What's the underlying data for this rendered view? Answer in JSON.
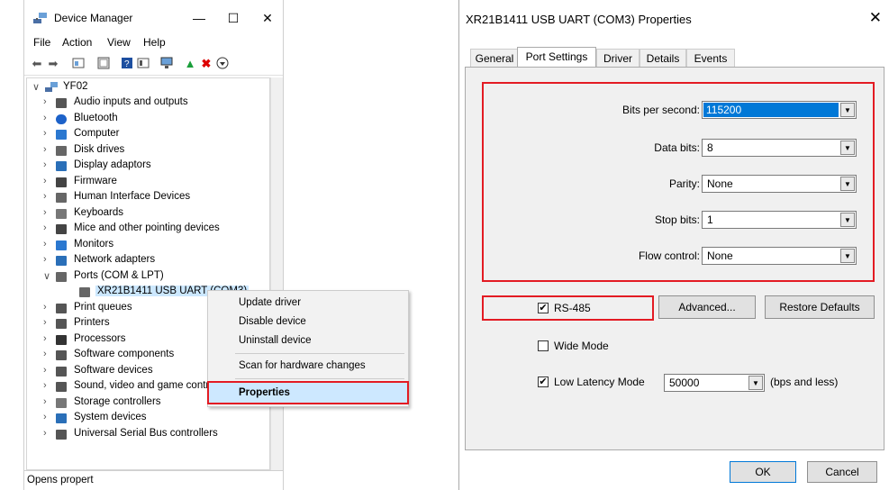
{
  "device_manager": {
    "title": "Device Manager",
    "menu": [
      "File",
      "Action",
      "View",
      "Help"
    ],
    "root": "YF02",
    "tree": [
      {
        "label": "Audio inputs and outputs",
        "icon": "speaker-icon"
      },
      {
        "label": "Bluetooth",
        "icon": "bluetooth-icon"
      },
      {
        "label": "Computer",
        "icon": "computer-icon"
      },
      {
        "label": "Disk drives",
        "icon": "disk-icon"
      },
      {
        "label": "Display adaptors",
        "icon": "display-adapter-icon"
      },
      {
        "label": "Firmware",
        "icon": "firmware-icon"
      },
      {
        "label": "Human Interface Devices",
        "icon": "hid-icon"
      },
      {
        "label": "Keyboards",
        "icon": "keyboard-icon"
      },
      {
        "label": "Mice and other pointing devices",
        "icon": "mouse-icon"
      },
      {
        "label": "Monitors",
        "icon": "monitor-icon"
      },
      {
        "label": "Network adapters",
        "icon": "network-icon"
      },
      {
        "label": "Ports (COM & LPT)",
        "icon": "port-icon",
        "expanded": true
      },
      {
        "label": "XR21B1411 USB UART (COM3)",
        "icon": "port-icon",
        "child": true,
        "selected": true
      },
      {
        "label": "Print queues",
        "icon": "printer-icon"
      },
      {
        "label": "Printers",
        "icon": "printer-icon"
      },
      {
        "label": "Processors",
        "icon": "processor-icon"
      },
      {
        "label": "Software components",
        "icon": "software-component-icon"
      },
      {
        "label": "Software devices",
        "icon": "software-device-icon"
      },
      {
        "label": "Sound, video and game controllers",
        "icon": "speaker-icon"
      },
      {
        "label": "Storage controllers",
        "icon": "storage-icon"
      },
      {
        "label": "System devices",
        "icon": "system-icon"
      },
      {
        "label": "Universal Serial Bus controllers",
        "icon": "usb-icon"
      }
    ],
    "status": "Opens propert",
    "context_menu": {
      "update": "Update driver",
      "disable": "Disable device",
      "uninstall": "Uninstall device",
      "scan": "Scan for hardware changes",
      "properties": "Properties"
    }
  },
  "dialog": {
    "title": "XR21B1411 USB UART (COM3) Properties",
    "tabs": [
      "General",
      "Port Settings",
      "Driver",
      "Details",
      "Events"
    ],
    "active_tab": "Port Settings",
    "fields": {
      "bits_per_second": {
        "label": "Bits per second:",
        "value": "115200"
      },
      "data_bits": {
        "label": "Data bits:",
        "value": "8"
      },
      "parity": {
        "label": "Parity:",
        "value": "None"
      },
      "stop_bits": {
        "label": "Stop bits:",
        "value": "1"
      },
      "flow_control": {
        "label": "Flow control:",
        "value": "None"
      }
    },
    "rs485": {
      "label": "RS-485",
      "checked": true
    },
    "advanced_label": "Advanced...",
    "restore_label": "Restore Defaults",
    "wide_mode": {
      "label": "Wide Mode",
      "checked": false
    },
    "low_latency": {
      "label": "Low Latency Mode",
      "checked": true,
      "value": "50000",
      "suffix": "(bps and less)"
    },
    "ok_label": "OK",
    "cancel_label": "Cancel"
  },
  "colors": {
    "highlight": "#e31b23",
    "selection": "#0078d7",
    "menu_hover": "#cde8ff"
  }
}
